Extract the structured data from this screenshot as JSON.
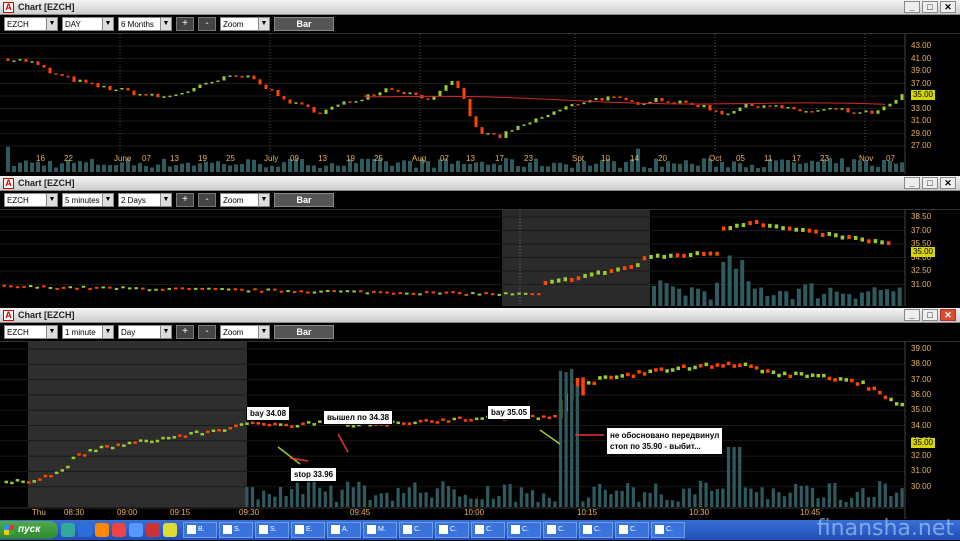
{
  "windows": [
    {
      "title": "Chart [EZCH]",
      "symbol": "EZCH",
      "interval": "DAY",
      "range": "6 Months",
      "zoom": "Zoom",
      "mode": "Bar",
      "plus": "+",
      "minus": "-",
      "x_labels": [
        "16",
        "22",
        "June",
        "07",
        "13",
        "19",
        "25",
        "July",
        "09",
        "13",
        "19",
        "25",
        "Aug",
        "07",
        "13",
        "17",
        "23",
        "Spt",
        "10",
        "14",
        "20",
        "Oct",
        "05",
        "11",
        "17",
        "23",
        "Nov",
        "07"
      ],
      "y_labels": [
        "43.00",
        "41.00",
        "39.00",
        "37.00",
        "35.00",
        "33.00",
        "31.00",
        "29.00",
        "27.00"
      ],
      "last_price": "35.00"
    },
    {
      "title": "Chart [EZCH]",
      "symbol": "EZCH",
      "interval": "5 minutes",
      "range": "2 Days",
      "zoom": "Zoom",
      "mode": "Bar",
      "plus": "+",
      "minus": "-",
      "y_labels": [
        "38.50",
        "37.00",
        "35.50",
        "34.00",
        "32.50",
        "31.00"
      ],
      "last_price": "35.00"
    },
    {
      "title": "Chart [EZCH]",
      "symbol": "EZCH",
      "interval": "1 minute",
      "range": "Day",
      "zoom": "Zoom",
      "mode": "Bar",
      "plus": "+",
      "minus": "-",
      "x_labels": [
        "Thu",
        "08:30",
        "09:00",
        "09:15",
        "09:30",
        "09:45",
        "10:00",
        "10:15",
        "10:30",
        "10:45"
      ],
      "y_labels": [
        "39.00",
        "38.00",
        "37.00",
        "36.00",
        "35.00",
        "34.00",
        "33.00",
        "32.00",
        "31.00",
        "30.00"
      ],
      "last_price": "35.00",
      "annotations": {
        "buy1": "bay 34.08",
        "stop1": "stop 33.96",
        "exit1": "вышел по 34.38",
        "buy2": "bay 35.05",
        "note": [
          "не обосновано  передвинул",
          "стоп по 35.90 - выбит..."
        ]
      }
    }
  ],
  "taskbar": {
    "start": "пуск",
    "tasks": [
      "B.",
      "S.",
      "S.",
      "E.",
      "A.",
      "M.",
      "C.",
      "C.",
      "C.",
      "C.",
      "C.",
      "C.",
      "C.",
      "C."
    ]
  },
  "watermark": "finansha.net",
  "colors": {
    "up": "#9acd32",
    "down": "#ff4500",
    "volume": "#2f5a5e",
    "ma": "#d42a2a",
    "axis": "#e8b35c"
  },
  "icons": {
    "app": "chart-app-icon",
    "minimize": "minimize-icon",
    "maximize": "maximize-icon",
    "close": "close-icon"
  }
}
